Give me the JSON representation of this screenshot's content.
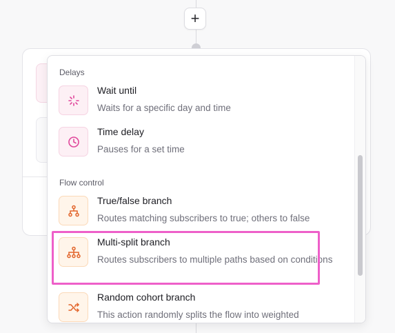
{
  "flow": {
    "add_label": "+"
  },
  "menu": {
    "sections": [
      {
        "title": "Delays",
        "items": [
          {
            "title": "Wait until",
            "desc": "Waits for a specific day and time",
            "icon": "loader-icon"
          },
          {
            "title": "Time delay",
            "desc": "Pauses for a set time",
            "icon": "clock-icon"
          }
        ]
      },
      {
        "title": "Flow control",
        "items": [
          {
            "title": "True/false branch",
            "desc": "Routes matching subscribers to true; others to false",
            "icon": "branch-icon"
          },
          {
            "title": "Multi-split branch",
            "desc": "Routes subscribers to multiple paths based on conditions",
            "icon": "multi-branch-icon"
          },
          {
            "title": "Random cohort branch",
            "desc": "This action randomly splits the flow into weighted",
            "icon": "shuffle-icon"
          }
        ]
      }
    ]
  },
  "colors": {
    "pink_accent": "#e0469b",
    "orange_accent": "#e2642a",
    "highlight": "#ee5fc9"
  }
}
